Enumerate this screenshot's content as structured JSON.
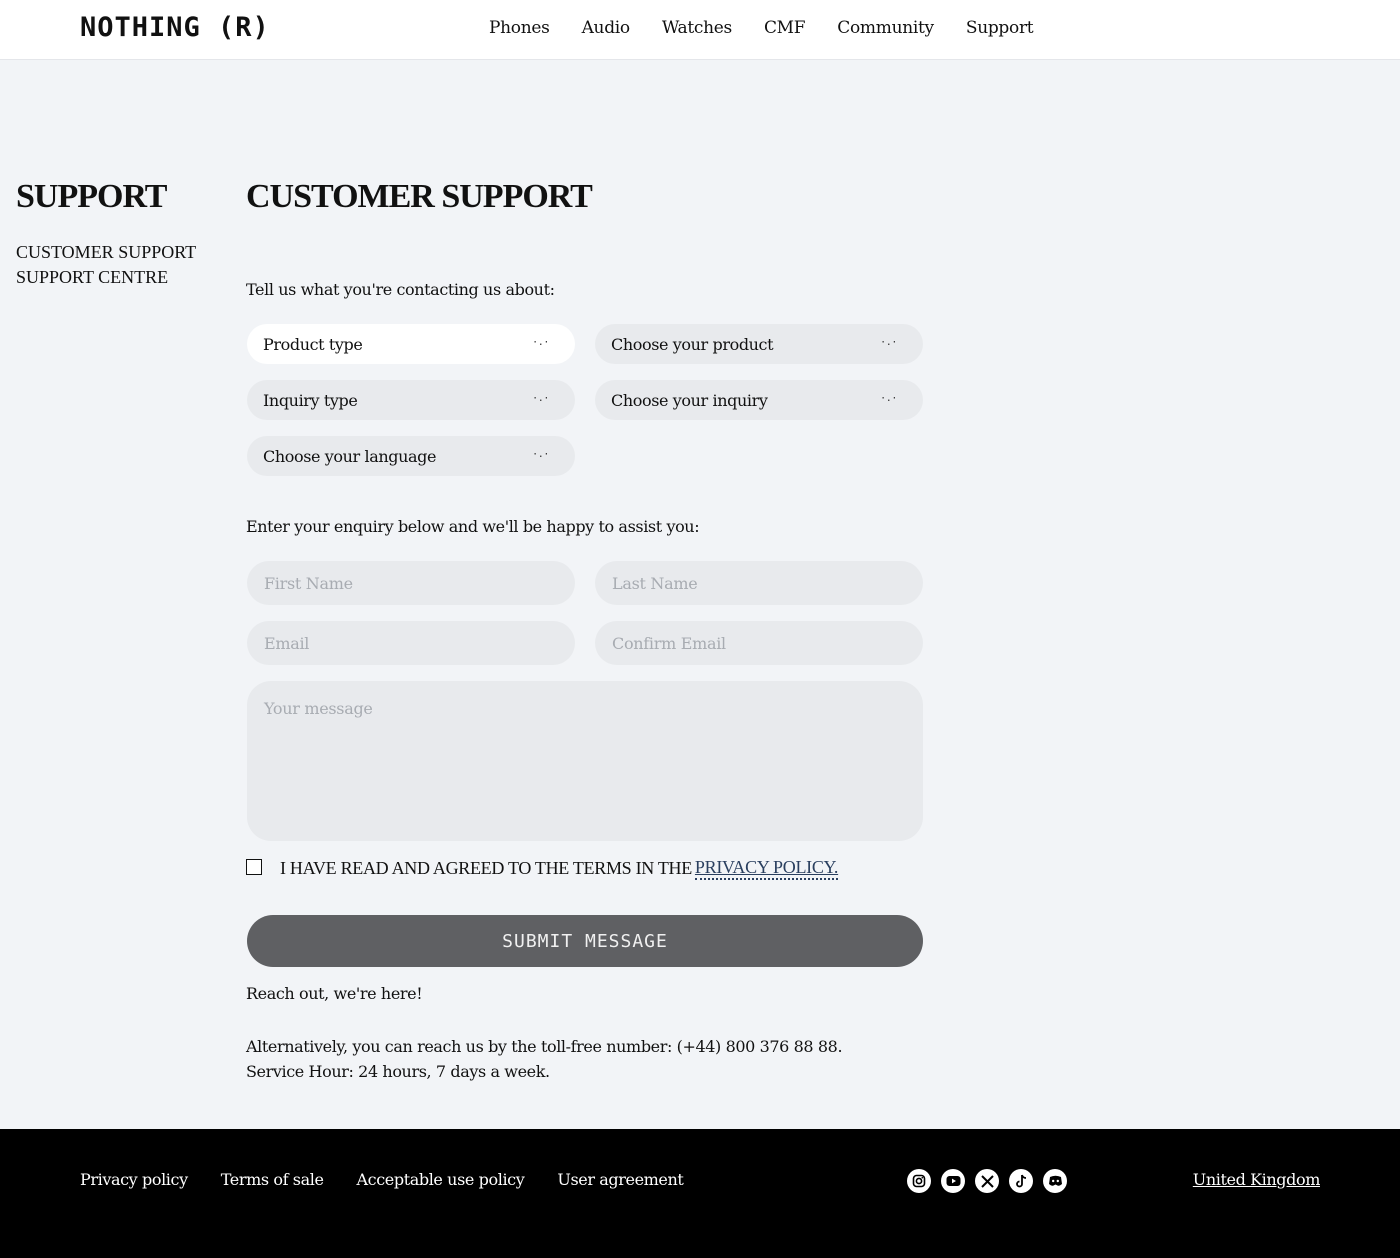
{
  "header": {
    "logo": "NOTHING (R)",
    "nav": [
      "Phones",
      "Audio",
      "Watches",
      "CMF",
      "Community",
      "Support"
    ]
  },
  "sidebar": {
    "title": "SUPPORT",
    "links": [
      "CUSTOMER SUPPORT",
      "SUPPORT CENTRE"
    ]
  },
  "main": {
    "title": "CUSTOMER SUPPORT",
    "prompt_contact": "Tell us what you're contacting us about:",
    "selects": {
      "product_type": "Product type",
      "choose_product": "Choose your product",
      "inquiry_type": "Inquiry type",
      "choose_inquiry": "Choose your inquiry",
      "choose_language": "Choose your language"
    },
    "prompt_enquiry": "Enter your enquiry below and we'll be happy to assist you:",
    "fields": {
      "first_name": "First Name",
      "last_name": "Last Name",
      "email": "Email",
      "confirm_email": "Confirm Email",
      "message": "Your message"
    },
    "consent_text": "I HAVE READ AND AGREED TO THE TERMS IN THE",
    "consent_link": "PRIVACY POLICY.",
    "submit_label": "SUBMIT MESSAGE",
    "reach_out": "Reach out, we're here!",
    "alt_line1": "Alternatively, you can reach us by the toll-free number: (+44) 800 376 88 88.",
    "alt_line2": "Service Hour: 24 hours, 7 days a week."
  },
  "footer": {
    "links": [
      "Privacy policy",
      "Terms of sale",
      "Acceptable use policy",
      "User agreement"
    ],
    "socials": [
      "instagram-icon",
      "youtube-icon",
      "x-icon",
      "tiktok-icon",
      "discord-icon"
    ],
    "region": "United Kingdom"
  },
  "colors": {
    "page_bg": "#f2f4f7",
    "field_bg": "#e8eaed",
    "submit_bg": "#5f6063",
    "footer_bg": "#000000",
    "link_accent": "#2a3f5f"
  }
}
